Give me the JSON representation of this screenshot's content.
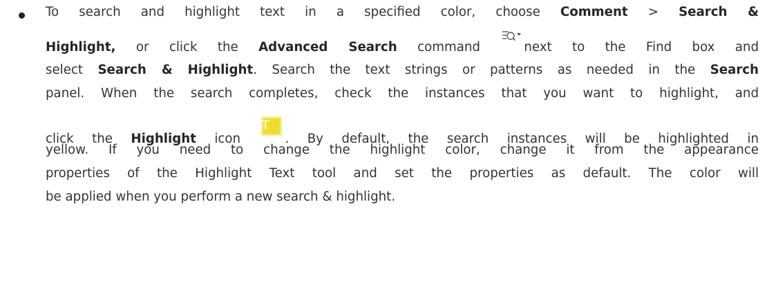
{
  "paragraph": {
    "line1": {
      "t1": "To search and highlight text in a specified color, choose ",
      "b1": "Comment",
      "t2": " > ",
      "b2": "Search &"
    },
    "line2": {
      "b1": "Highlight,",
      "t1": " or click the ",
      "b2": "Advanced Search",
      "t2": " command ",
      "t3": "next to the Find box and"
    },
    "line3": {
      "t1": "select ",
      "b1": "Search & Highlight",
      "t2": ". Search the text strings or patterns as needed in the ",
      "b2": "Search"
    },
    "line4": {
      "t1": "panel. When the search completes, check the instances that you want to highlight, and"
    },
    "line5": {
      "t1": "click the ",
      "b1": "Highlight",
      "t2": " icon ",
      "t3": ". By default, the search instances will be highlighted in"
    },
    "line6": {
      "t1": "yellow. If you need to change the highlight color, change it from the appearance"
    },
    "line7": {
      "t1": "properties of the Highlight Text tool and set the properties as default. The color will"
    },
    "line8": {
      "t1": "be applied when you perform a new search & highlight."
    }
  },
  "icons": {
    "advanced_search": "advanced-search-icon",
    "highlight": "highlight-icon",
    "highlight_glyph": "T",
    "highlight_color": "#f0dc2c"
  }
}
